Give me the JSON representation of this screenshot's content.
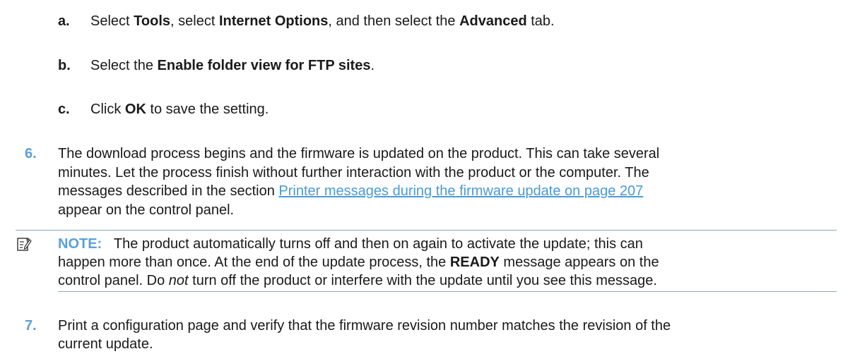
{
  "substeps": [
    {
      "letter": "a.",
      "parts": [
        "Select ",
        "Tools",
        ", select ",
        "Internet Options",
        ", and then select the ",
        "Advanced",
        " tab."
      ]
    },
    {
      "letter": "b.",
      "parts": [
        "Select the ",
        "Enable folder view for FTP sites",
        "."
      ]
    },
    {
      "letter": "c.",
      "parts": [
        "Click ",
        "OK",
        " to save the setting."
      ]
    }
  ],
  "step6": {
    "number": "6.",
    "line1": "The download process begins and the firmware is updated on the product. This can take several",
    "line2": "minutes. Let the process finish without further interaction with the product or the computer. The",
    "line3_pre": "messages described in the section ",
    "line3_link": "Printer messages during the firmware update  on page 207",
    "line4": "appear on the control panel."
  },
  "note": {
    "icon": "note-pencil-icon",
    "label": "NOTE:",
    "line1": "The product automatically turns off and then on again to activate the update; this can",
    "line2_pre": "happen more than once. At the end of the update process, the ",
    "line2_bold": "READY",
    "line2_post": " message appears on the",
    "line3_pre": "control panel. Do ",
    "line3_italic": "not",
    "line3_post": " turn off the product or interfere with the update until you see this message."
  },
  "step7": {
    "number": "7.",
    "line1": "Print a configuration page and verify that the firmware revision number matches the revision of the",
    "line2": "current update."
  },
  "colors": {
    "step_number": "#5aa0d8",
    "link": "#4a9ad6",
    "note_rule": "#8aa8c8",
    "text": "#1a1a1a"
  }
}
